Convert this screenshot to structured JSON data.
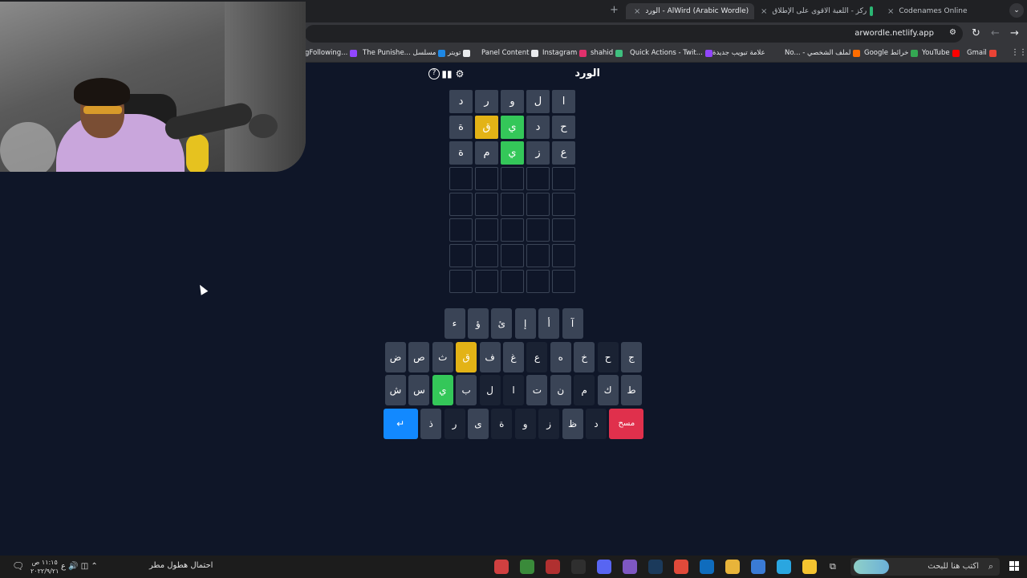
{
  "browser": {
    "active_tab": {
      "title": "الورد - AlWird (Arabic Wordle)",
      "close": "×"
    },
    "tabs": [
      {
        "title": "ركز - اللعبة الاقوى على الإطلاق",
        "close": "×"
      },
      {
        "title": "Codenames Online",
        "close": "×"
      }
    ],
    "new_tab": "+",
    "tab_search": "⌄",
    "url": "arwordle.netlify.app",
    "site_settings_icon": "⚙",
    "reload": "↻",
    "back": "←",
    "forward": "→",
    "bookmarks": [
      {
        "label": "gFollowing...",
        "color": "#9146ff"
      },
      {
        "label": "The Punishe... مسلسل",
        "color": "#1e88e5"
      },
      {
        "label": "تويتر",
        "color": "#ffffff"
      },
      {
        "label": "Panel Content",
        "color": "#ffffff"
      },
      {
        "label": "Instagram",
        "color": "#e1306c"
      },
      {
        "label": "shahid",
        "color": "#3fbf7f"
      },
      {
        "label": "Quick Actions - Twit...",
        "color": "#9146ff"
      },
      {
        "label": "علامة تبويب جديدة",
        "color": "#555555"
      },
      {
        "label": "No... - لملف الشخصي",
        "color": "#ff6d00"
      },
      {
        "label": "Google خرائط",
        "color": "#34a853"
      },
      {
        "label": "YouTube",
        "color": "#ff0000"
      },
      {
        "label": "Gmail",
        "color": "#ea4335"
      }
    ],
    "apps_icon": "⋮⋮"
  },
  "game": {
    "title": "الورد",
    "icons": {
      "help": "?",
      "stats": "▮▮",
      "settings": "⚙"
    },
    "board": [
      [
        {
          "letter": "ا",
          "state": "absent"
        },
        {
          "letter": "ل",
          "state": "absent"
        },
        {
          "letter": "و",
          "state": "absent"
        },
        {
          "letter": "ر",
          "state": "absent"
        },
        {
          "letter": "د",
          "state": "absent"
        }
      ],
      [
        {
          "letter": "ح",
          "state": "absent"
        },
        {
          "letter": "د",
          "state": "absent"
        },
        {
          "letter": "ي",
          "state": "correct"
        },
        {
          "letter": "ق",
          "state": "present"
        },
        {
          "letter": "ة",
          "state": "absent"
        }
      ],
      [
        {
          "letter": "ع",
          "state": "absent"
        },
        {
          "letter": "ز",
          "state": "absent"
        },
        {
          "letter": "ي",
          "state": "correct"
        },
        {
          "letter": "م",
          "state": "absent"
        },
        {
          "letter": "ة",
          "state": "absent"
        }
      ],
      [
        {
          "letter": "",
          "state": "empty"
        },
        {
          "letter": "",
          "state": "empty"
        },
        {
          "letter": "",
          "state": "empty"
        },
        {
          "letter": "",
          "state": "empty"
        },
        {
          "letter": "",
          "state": "empty"
        }
      ],
      [
        {
          "letter": "",
          "state": "empty"
        },
        {
          "letter": "",
          "state": "empty"
        },
        {
          "letter": "",
          "state": "empty"
        },
        {
          "letter": "",
          "state": "empty"
        },
        {
          "letter": "",
          "state": "empty"
        }
      ],
      [
        {
          "letter": "",
          "state": "empty"
        },
        {
          "letter": "",
          "state": "empty"
        },
        {
          "letter": "",
          "state": "empty"
        },
        {
          "letter": "",
          "state": "empty"
        },
        {
          "letter": "",
          "state": "empty"
        }
      ],
      [
        {
          "letter": "",
          "state": "empty"
        },
        {
          "letter": "",
          "state": "empty"
        },
        {
          "letter": "",
          "state": "empty"
        },
        {
          "letter": "",
          "state": "empty"
        },
        {
          "letter": "",
          "state": "empty"
        }
      ],
      [
        {
          "letter": "",
          "state": "empty"
        },
        {
          "letter": "",
          "state": "empty"
        },
        {
          "letter": "",
          "state": "empty"
        },
        {
          "letter": "",
          "state": "empty"
        },
        {
          "letter": "",
          "state": "empty"
        }
      ]
    ],
    "keyboard": [
      [
        {
          "label": "آ",
          "state": "default"
        },
        {
          "label": "أ",
          "state": "default"
        },
        {
          "label": "إ",
          "state": "default"
        },
        {
          "label": "ئ",
          "state": "default"
        },
        {
          "label": "ؤ",
          "state": "default"
        },
        {
          "label": "ء",
          "state": "default"
        }
      ],
      [
        {
          "label": "ج",
          "state": "default"
        },
        {
          "label": "ح",
          "state": "absent"
        },
        {
          "label": "خ",
          "state": "default"
        },
        {
          "label": "ه",
          "state": "default"
        },
        {
          "label": "ع",
          "state": "absent"
        },
        {
          "label": "غ",
          "state": "default"
        },
        {
          "label": "ف",
          "state": "default"
        },
        {
          "label": "ق",
          "state": "present"
        },
        {
          "label": "ث",
          "state": "default"
        },
        {
          "label": "ص",
          "state": "default"
        },
        {
          "label": "ض",
          "state": "default"
        }
      ],
      [
        {
          "label": "ط",
          "state": "default"
        },
        {
          "label": "ك",
          "state": "default"
        },
        {
          "label": "م",
          "state": "absent"
        },
        {
          "label": "ن",
          "state": "default"
        },
        {
          "label": "ت",
          "state": "default"
        },
        {
          "label": "ا",
          "state": "absent"
        },
        {
          "label": "ل",
          "state": "absent"
        },
        {
          "label": "ب",
          "state": "default"
        },
        {
          "label": "ي",
          "state": "correct"
        },
        {
          "label": "س",
          "state": "default"
        },
        {
          "label": "ش",
          "state": "default"
        }
      ],
      [
        {
          "label": "مسح",
          "state": "delete"
        },
        {
          "label": "د",
          "state": "absent"
        },
        {
          "label": "ظ",
          "state": "default"
        },
        {
          "label": "ز",
          "state": "absent"
        },
        {
          "label": "و",
          "state": "absent"
        },
        {
          "label": "ة",
          "state": "absent"
        },
        {
          "label": "ى",
          "state": "default"
        },
        {
          "label": "ر",
          "state": "absent"
        },
        {
          "label": "ذ",
          "state": "default"
        },
        {
          "label": "↵",
          "state": "enter"
        }
      ]
    ]
  },
  "taskbar": {
    "search_placeholder": "اكتب هنا للبحث",
    "search_icon": "⌕",
    "task_view_icon": "⧉",
    "weather": "احتمال هطول مطر",
    "tray": "ع  🔊  ◫  ⌃",
    "time": "١١:١٥ ص",
    "date": "٢٠٢٢/٩/٢١",
    "notify_icon": "🗨",
    "apps": [
      {
        "name": "explorer",
        "color": "#f4c430"
      },
      {
        "name": "edge",
        "color": "#2aa6e0"
      },
      {
        "name": "store",
        "color": "#3a7bd5"
      },
      {
        "name": "files",
        "color": "#e8b43a"
      },
      {
        "name": "outlook",
        "color": "#0f6cbd"
      },
      {
        "name": "chrome",
        "color": "#e04a3a"
      },
      {
        "name": "steam",
        "color": "#1b3a5b"
      },
      {
        "name": "photos",
        "color": "#7e57c2"
      },
      {
        "name": "discord",
        "color": "#5865f2"
      },
      {
        "name": "xbox",
        "color": "#2f2f2f"
      },
      {
        "name": "app-red",
        "color": "#b03030"
      },
      {
        "name": "app-green",
        "color": "#3a8a3a"
      },
      {
        "name": "app-rainbow",
        "color": "#d04040"
      }
    ]
  }
}
